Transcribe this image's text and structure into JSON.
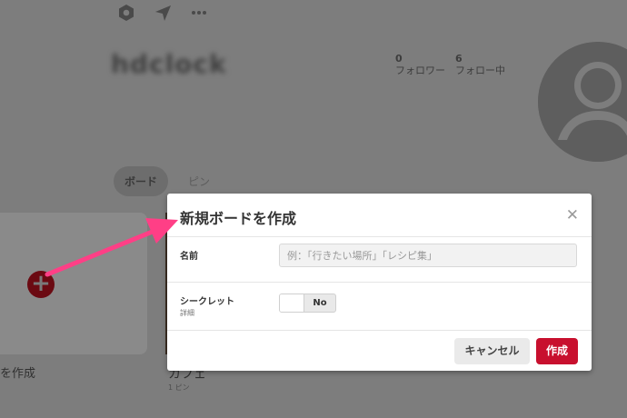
{
  "profile": {
    "username": "hdclock",
    "stats": [
      {
        "count": "0",
        "label": "フォロワー"
      },
      {
        "count": "6",
        "label": "フォロー中"
      }
    ],
    "tabs": [
      "ボード",
      "ピン"
    ],
    "create_board_label": "を作成",
    "create_plus": "+",
    "board_title": "カフェ",
    "board_pin_count": "1 ピン"
  },
  "icons": {
    "settings": "hexagon-gear-icon",
    "send": "paper-plane-icon",
    "more": "ellipsis-icon",
    "close": "close-icon",
    "avatar": "user-avatar-icon"
  },
  "dialog": {
    "title": "新規ボードを作成",
    "close_glyph": "✕",
    "name_label": "名前",
    "name_placeholder": "例：「行きたい場所」「レシピ集」",
    "name_value": "",
    "secret_label": "シークレット",
    "secret_sublabel": "詳細",
    "secret_toggle_text": "No",
    "cancel_label": "キャンセル",
    "create_label": "作成"
  },
  "colors": {
    "accent": "#c8102e",
    "overlay": "#7d7d7d",
    "annotation_arrow": "#ff3f86"
  }
}
